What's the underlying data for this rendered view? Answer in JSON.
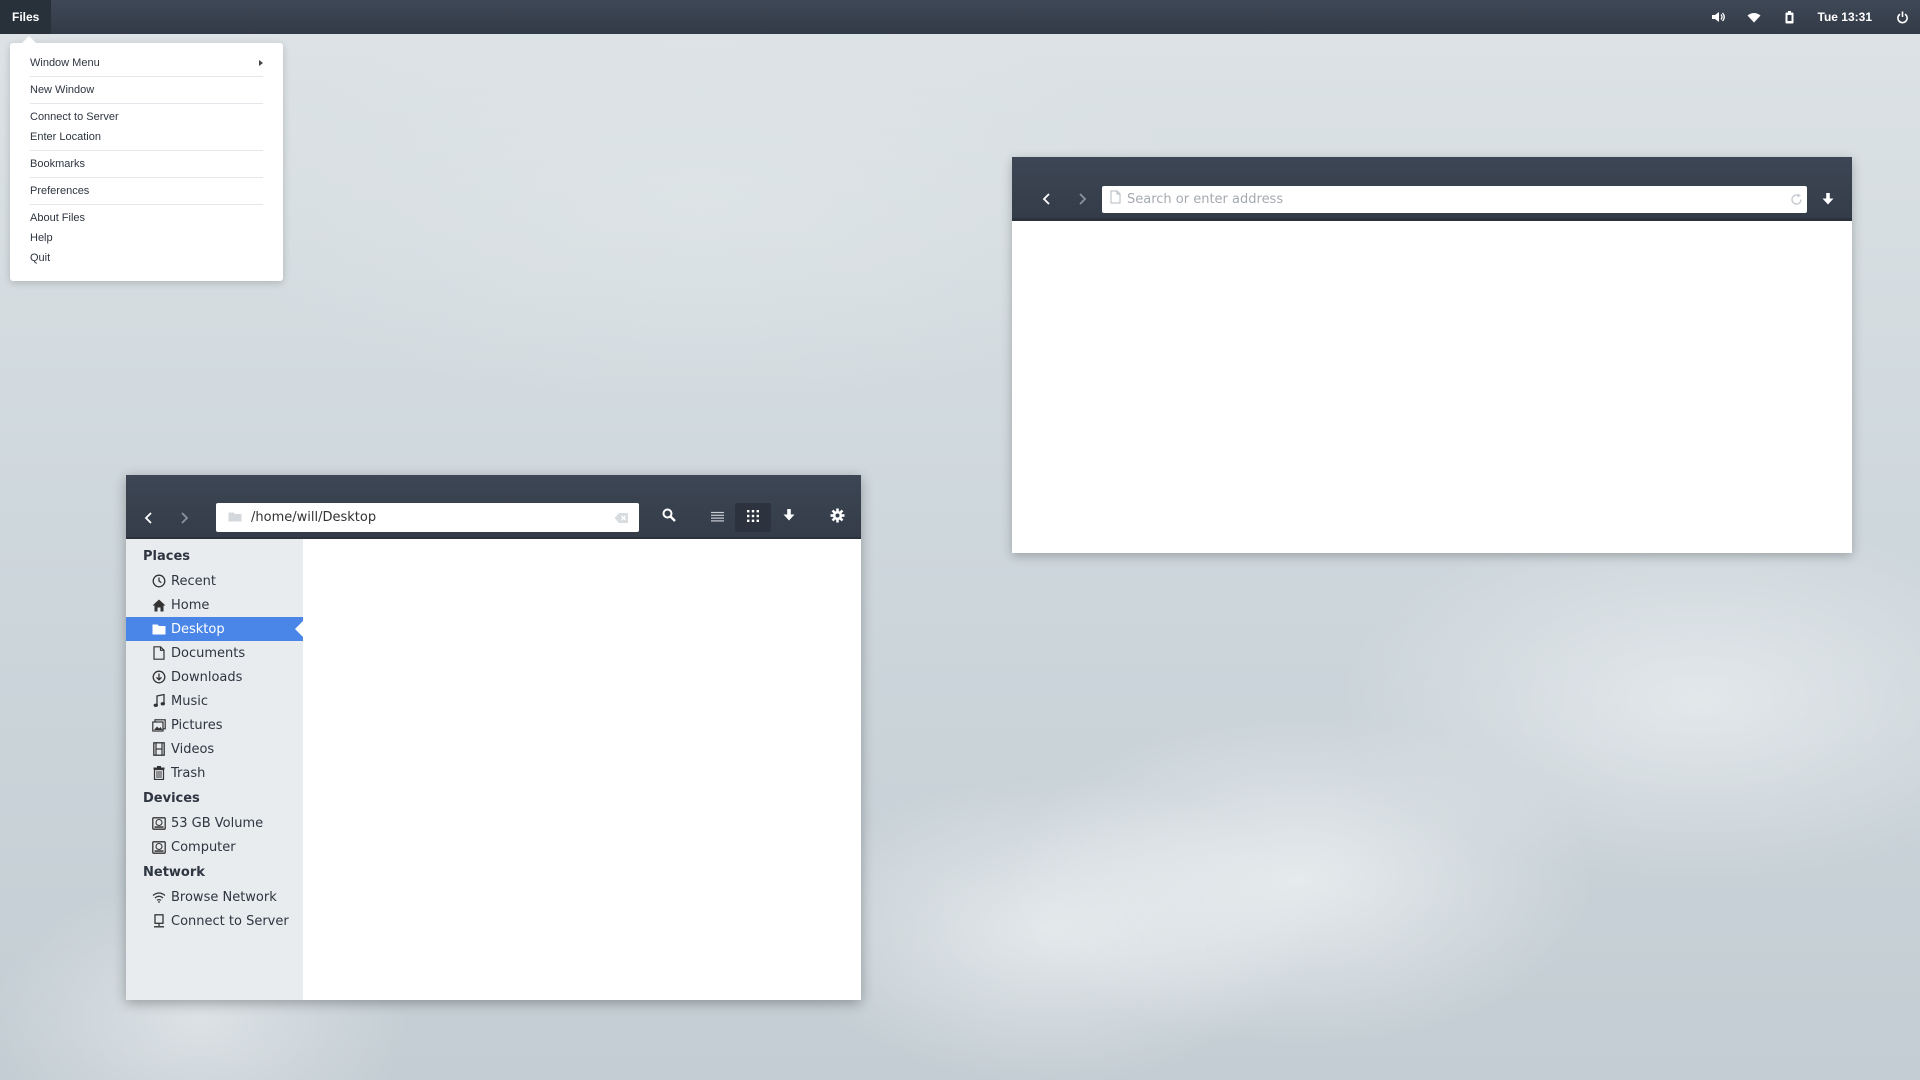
{
  "topbar": {
    "app_name": "Files",
    "clock": "Tue 13:31",
    "icons": [
      "volume-icon",
      "wifi-icon",
      "battery-icon",
      "power-icon"
    ]
  },
  "app_menu": {
    "items": [
      {
        "label": "Window Menu",
        "submenu": true
      },
      {
        "label": "New Window"
      },
      {
        "label": "Connect to Server"
      },
      {
        "label": "Enter Location"
      },
      {
        "label": "Bookmarks"
      },
      {
        "label": "Preferences"
      },
      {
        "label": "About Files"
      },
      {
        "label": "Help"
      },
      {
        "label": "Quit"
      }
    ]
  },
  "browser": {
    "address_placeholder": "Search or enter address",
    "address_value": ""
  },
  "files": {
    "path": "/home/will/Desktop",
    "sidebar": {
      "places_title": "Places",
      "places": [
        {
          "label": "Recent",
          "icon": "clock-icon"
        },
        {
          "label": "Home",
          "icon": "home-icon"
        },
        {
          "label": "Desktop",
          "icon": "folder-icon",
          "selected": true
        },
        {
          "label": "Documents",
          "icon": "document-icon"
        },
        {
          "label": "Downloads",
          "icon": "download-icon"
        },
        {
          "label": "Music",
          "icon": "music-icon"
        },
        {
          "label": "Pictures",
          "icon": "pictures-icon"
        },
        {
          "label": "Videos",
          "icon": "film-icon"
        },
        {
          "label": "Trash",
          "icon": "trash-icon"
        }
      ],
      "devices_title": "Devices",
      "devices": [
        {
          "label": "53 GB Volume",
          "icon": "drive-icon"
        },
        {
          "label": "Computer",
          "icon": "drive-icon"
        }
      ],
      "network_title": "Network",
      "network": [
        {
          "label": "Browse Network",
          "icon": "wifi-icon"
        },
        {
          "label": "Connect to Server",
          "icon": "server-icon"
        }
      ]
    }
  },
  "colors": {
    "header": "#3a4250",
    "selection": "#4a86e8",
    "sidebar": "#e9ecef"
  }
}
